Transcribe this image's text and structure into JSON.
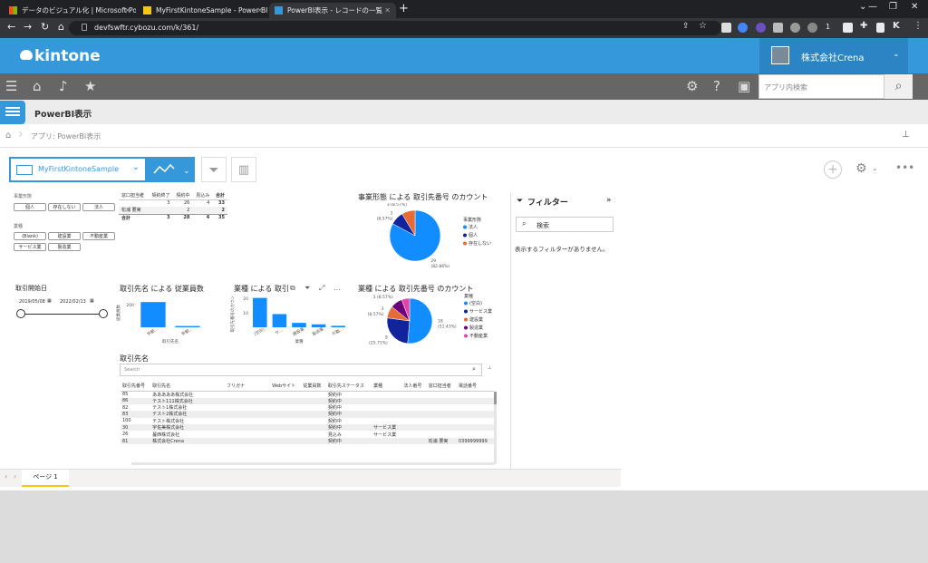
{
  "browser": {
    "tabs": [
      {
        "title": "データのビジュアル化 | Microsoft Po..."
      },
      {
        "title": "MyFirstKintoneSample - Power BI"
      },
      {
        "title": "PowerBI表示 - レコードの一覧"
      }
    ],
    "url": "devfswftr.cybozu.com/k/361/",
    "ext_badge": "1"
  },
  "kintone": {
    "logo": "kintone",
    "user": "株式会社Crena",
    "app_search_placeholder": "アプリ内検索",
    "app_title": "PowerBI表示",
    "breadcrumb": "アプリ: PowerBI表示",
    "view_name": "MyFirstKintoneSample"
  },
  "report": {
    "slicer1_title": "事業形態",
    "slicer1_items": [
      "個人",
      "存在しない",
      "法人"
    ],
    "slicer2_title": "業種",
    "slicer2_items": [
      "(Blank)",
      "建設業",
      "不動産業",
      "サービス業",
      "製造業"
    ],
    "matrix": {
      "headers": [
        "窓口担当者",
        "契約終了",
        "契約中",
        "見込み",
        "合計"
      ],
      "rows": [
        [
          "",
          "3",
          "26",
          "4",
          "33"
        ],
        [
          "松浦 要実",
          "",
          "2",
          "",
          "2"
        ],
        [
          "合計",
          "3",
          "28",
          "4",
          "35"
        ]
      ]
    },
    "date_slicer": {
      "title": "取引開始日",
      "from": "2019/05/08",
      "to": "2022/02/13"
    },
    "filter_pane": {
      "title": "フィルター",
      "search": "検索",
      "message": "表示するフィルターがありません。"
    },
    "page_tab": "ページ 1",
    "table_visual": {
      "title": "取引先名",
      "search_placeholder": "Search",
      "columns": [
        "取引先番号",
        "取引先名",
        "フリガナ",
        "Webサイト",
        "従業員数",
        "取引先ステータス",
        "業種",
        "法人番号",
        "窓口担当者",
        "電話番号"
      ],
      "rows": [
        [
          "85",
          "あああああ株式会社",
          "",
          "",
          "",
          "契約中",
          "",
          "",
          "",
          ""
        ],
        [
          "86",
          "テスト111株式会社",
          "",
          "",
          "",
          "契約中",
          "",
          "",
          "",
          ""
        ],
        [
          "82",
          "テスト1株式会社",
          "",
          "",
          "",
          "契約中",
          "",
          "",
          "",
          ""
        ],
        [
          "83",
          "テスト2株式会社",
          "",
          "",
          "",
          "契約中",
          "",
          "",
          "",
          ""
        ],
        [
          "100",
          "テスト株式会社",
          "",
          "",
          "",
          "契約中",
          "",
          "",
          "",
          ""
        ],
        [
          "30",
          "宇佐美株式会社",
          "",
          "",
          "",
          "契約中",
          "サービス業",
          "",
          "",
          ""
        ],
        [
          "26",
          "蔓西株式会社",
          "",
          "",
          "",
          "見込み",
          "サービス業",
          "",
          "",
          ""
        ],
        [
          "81",
          "株式会社Crena",
          "",
          "",
          "",
          "契約中",
          "",
          "",
          "松浦 要実",
          "0399999999"
        ]
      ]
    }
  },
  "chart_data": [
    {
      "type": "pie",
      "title": "事業形態 による 取引先番号 のカウント",
      "legend_title": "事業形態",
      "categories": [
        "法人",
        "個人",
        "存在しない"
      ],
      "values": [
        29,
        3,
        3
      ],
      "labels": [
        "29\n(82.86%)",
        "3\n(8.57%)",
        "3 (8.57%)"
      ],
      "colors": [
        "#118dff",
        "#12239e",
        "#e66c37"
      ]
    },
    {
      "type": "bar",
      "title": "取引先名 による 従業員数",
      "xlabel": "取引先名",
      "ylabel": "従業員数",
      "categories": [
        "宇都...",
        "宇都..."
      ],
      "values": [
        200,
        10
      ],
      "ytick": "200"
    },
    {
      "type": "bar",
      "title": "業種 による 取引",
      "xlabel": "業種",
      "ylabel": "取引先番号のカウント",
      "categories": [
        "(空白)",
        "サ...",
        "建設業",
        "製造業",
        "不動..."
      ],
      "values": [
        20,
        9,
        3,
        2,
        1
      ],
      "yticks": [
        "20",
        "10"
      ]
    },
    {
      "type": "pie",
      "title": "業種 による 取引先番号 のカウント",
      "legend_title": "業種",
      "categories": [
        "(空白)",
        "サービス業",
        "建設業",
        "製造業",
        "不動産業"
      ],
      "values": [
        18,
        9,
        3,
        3,
        2
      ],
      "labels": [
        "18\n(51.43%)",
        "9\n(25.71%)",
        "3\n(8.57%)",
        "3 (8.57%)",
        "2"
      ],
      "colors": [
        "#118dff",
        "#12239e",
        "#e66c37",
        "#6b007b",
        "#e044a7"
      ]
    }
  ]
}
